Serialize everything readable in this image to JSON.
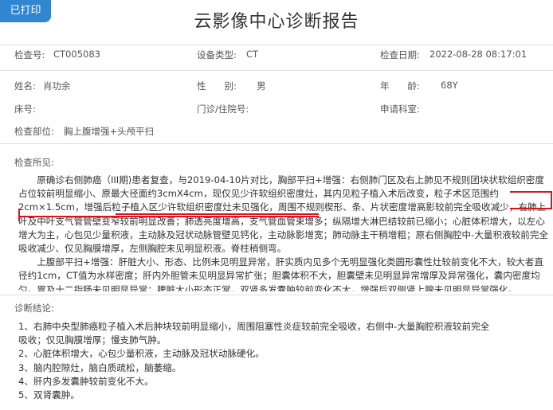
{
  "badge": "已打印",
  "title": "云影像中心诊断报告",
  "info": {
    "exam_no_label": "检查号:",
    "exam_no": "CT005083",
    "device_label": "设备类型:",
    "device": "CT",
    "date_label": "检查日期:",
    "date": "2022-08-28 08:17:01",
    "name_label": "姓名:",
    "name": "肖功余",
    "sex_label": "性　　别:",
    "sex": "男",
    "age_label": "年　　龄:",
    "age": "68Y",
    "bed_label": "床号:",
    "clinic_label": "门诊/住院号:",
    "dept_label": "申请科室:",
    "part_label": "检查部位:",
    "part": "胸上腹增强+头颅平扫"
  },
  "findings": {
    "label": "检查所见:",
    "p1": "原确诊右侧肺癌（III期)患者复查，与2019-04-10片对比，胸部平扫+增强：右侧肺门区及右上肺见不规则团块状软组织密度占位较前明显缩小、原最大径面约3cmX4cm，现仅见少许软组织密度灶，其内见粒子植入术后改变，粒子术区范围约2cm×1.5cm，增强后粒子植入区少许软组织密度灶未见强化，周围不规则楔形、条、片状密度增高影较前完全吸收减少，右肺上叶及中叶支气管管壁变窄较前明显改善；肺透亮度增高，支气管血管束增多；纵隔增大淋巴结较前已缩小；心脏体积增大，以左心增大为主，心包见少量积液，主动脉及冠状动脉管壁见钙化，主动脉影增宽；肺动脉主干稍增粗；原右侧胸腔中-大量积液较前完全吸收减少、仅见胸膜增厚，左侧胸腔未见明显积液。脊柱稍侧弯。",
    "p2": "上腹部平扫+增强：肝脏大小、形态、比例未见明显异常，肝实质内见多个无明显强化类圆形囊性灶较前变化不大，较大者直径约1cm，CT值为水样密度；肝内外胆管未见明显异常扩张；胆囊体积不大，胆囊壁未见明显异常增厚及异常强化，囊内密度均匀。胃及十二指肠未见明显异常；脾脏大小形态正常，双肾多发囊肿较前变化不大，增强后双侧肾上腺未见明显异常强化。"
  },
  "conclusion": {
    "label": "诊断结论:",
    "items": [
      "1、右肺中央型肺癌粒子植入术后肿块较前明显缩小，周围阻塞性炎症较前完全吸收，右侧中-大量胸腔积液较前完全",
      "吸收；仅见胸膜增厚；慢支肺气肿。",
      "2、心脏体积增大，心包少量积液，主动脉及冠状动脉硬化。",
      "3、脑内腔隙灶，脑白质疏松，脑萎缩。",
      "4、肝内多发囊肿较前变化不大。",
      "5、双肾囊肿。"
    ]
  },
  "colors": {
    "badge": "#2f86d1",
    "annotation": "#d8141e"
  }
}
